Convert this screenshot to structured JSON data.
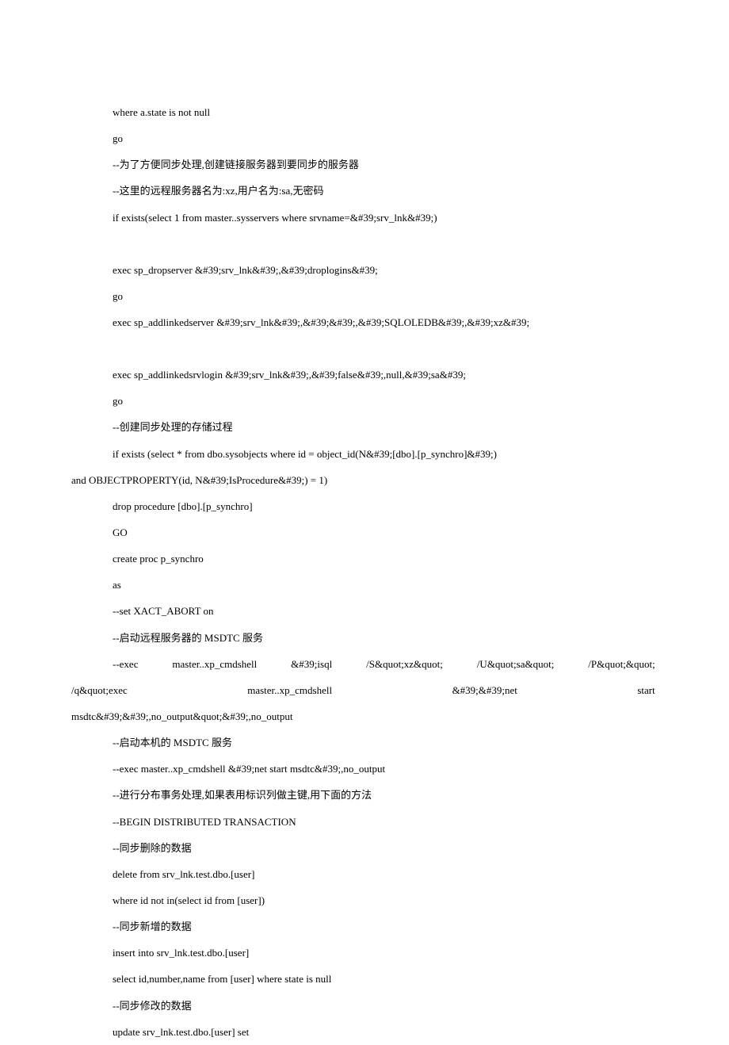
{
  "lines": [
    {
      "cls": "line indent",
      "text": "where a.state is not null"
    },
    {
      "cls": "line indent",
      "text": "go"
    },
    {
      "cls": "line indent",
      "text": "--为了方便同步处理,创建链接服务器到要同步的服务器"
    },
    {
      "cls": "line indent",
      "text": "--这里的远程服务器名为:xz,用户名为:sa,无密码"
    },
    {
      "cls": "line indent",
      "text": "if exists(select 1 from master..sysservers where srvname=&#39;srv_lnk&#39;)"
    },
    {
      "cls": "blank",
      "text": ""
    },
    {
      "cls": "line indent",
      "text": "exec sp_dropserver &#39;srv_lnk&#39;,&#39;droplogins&#39;"
    },
    {
      "cls": "line indent",
      "text": "go"
    },
    {
      "cls": "line indent",
      "text": "exec sp_addlinkedserver &#39;srv_lnk&#39;,&#39;&#39;,&#39;SQLOLEDB&#39;,&#39;xz&#39;"
    },
    {
      "cls": "blank",
      "text": ""
    },
    {
      "cls": "line indent",
      "text": "exec sp_addlinkedsrvlogin &#39;srv_lnk&#39;,&#39;false&#39;,null,&#39;sa&#39;"
    },
    {
      "cls": "line indent",
      "text": "go"
    },
    {
      "cls": "line indent",
      "text": "--创建同步处理的存储过程"
    },
    {
      "cls": "line indent",
      "text": "if exists (select * from dbo.sysobjects where id = object_id(N&#39;[dbo].[p_synchro]&#39;) "
    },
    {
      "cls": "line",
      "text": "and OBJECTPROPERTY(id, N&#39;IsProcedure&#39;) = 1)"
    },
    {
      "cls": "line indent",
      "text": "drop procedure [dbo].[p_synchro]"
    },
    {
      "cls": "line indent",
      "text": "GO"
    },
    {
      "cls": "line indent",
      "text": "create proc p_synchro"
    },
    {
      "cls": "line indent",
      "text": "as"
    },
    {
      "cls": "line indent",
      "text": "--set XACT_ABORT on"
    },
    {
      "cls": "line indent",
      "text": "--启动远程服务器的 MSDTC 服务"
    },
    {
      "cls": "line indent justify",
      "text": "--exec master..xp_cmdshell &#39;isql /S&quot;xz&quot; /U&quot;sa&quot; /P&quot;&quot; "
    },
    {
      "cls": "line justify",
      "text": "/q&quot;exec master..xp_cmdshell &#39;&#39;net start "
    },
    {
      "cls": "line",
      "text": "msdtc&#39;&#39;,no_output&quot;&#39;,no_output"
    },
    {
      "cls": "line indent",
      "text": "--启动本机的 MSDTC 服务"
    },
    {
      "cls": "line indent",
      "text": "--exec master..xp_cmdshell &#39;net start msdtc&#39;,no_output"
    },
    {
      "cls": "line indent",
      "text": "--进行分布事务处理,如果表用标识列做主键,用下面的方法"
    },
    {
      "cls": "line indent",
      "text": "--BEGIN DISTRIBUTED TRANSACTION"
    },
    {
      "cls": "line indent",
      "text": "--同步删除的数据"
    },
    {
      "cls": "line indent",
      "text": "delete from srv_lnk.test.dbo.[user]"
    },
    {
      "cls": "line indent",
      "text": "where id not in(select id from [user])"
    },
    {
      "cls": "line indent",
      "text": "--同步新增的数据"
    },
    {
      "cls": "line indent",
      "text": "insert into srv_lnk.test.dbo.[user]"
    },
    {
      "cls": "line indent",
      "text": "select id,number,name from [user] where state is null"
    },
    {
      "cls": "line indent",
      "text": "--同步修改的数据"
    },
    {
      "cls": "line indent",
      "text": "update srv_lnk.test.dbo.[user] set"
    }
  ]
}
